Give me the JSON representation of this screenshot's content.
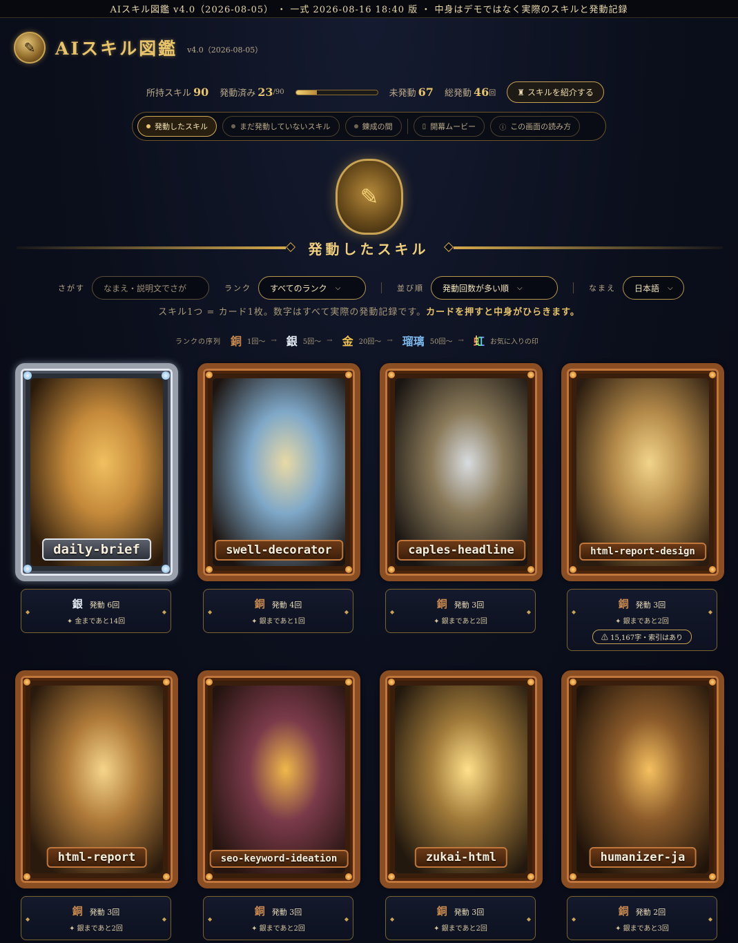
{
  "topbar": {
    "text": "AIスキル図鑑 v4.0（2026-08-05） ・ 一式 2026-08-16 18:40 版 ・ 中身はデモではなく実際のスキルと発動記録"
  },
  "header": {
    "title": "AIスキル図鑑",
    "version": "v4.0（2026-08-05）",
    "logo_icon": "book-emblem-icon"
  },
  "stats": {
    "owned_label": "所持スキル",
    "owned": "90",
    "used_label": "発動済み",
    "used": "23",
    "used_total": "/90",
    "progress_fraction": 0.2556,
    "unused_label": "未発動",
    "unused": "67",
    "total_label": "総発動",
    "total": "46",
    "total_unit": "回",
    "intro_button": "スキルを紹介する"
  },
  "nav": {
    "tabs": [
      {
        "label": "発動したスキル",
        "active": true
      },
      {
        "label": "まだ発動していないスキル",
        "active": false
      },
      {
        "label": "錬成の間",
        "active": false
      }
    ],
    "movie_label": "開幕ムービー",
    "howto_label": "この画面の読み方"
  },
  "section": {
    "title": "発動したスキル"
  },
  "filters": {
    "search_label": "さがす",
    "search_placeholder": "なまえ・説明文でさが",
    "rank_label": "ランク",
    "rank_value": "すべてのランク",
    "sort_label": "並び順",
    "sort_value": "発動回数が多い順",
    "name_label": "なまえ",
    "name_value": "日本語"
  },
  "note": {
    "text": "スキル1つ = カード1枚。数字はすべて実際の発動記録です。",
    "emphasis": "カードを押すと中身がひらきます。"
  },
  "ranks": {
    "label": "ランクの序列",
    "items": [
      {
        "glyph": "銅",
        "desc": "1回〜"
      },
      {
        "glyph": "銀",
        "desc": "5回〜"
      },
      {
        "glyph": "金",
        "desc": "20回〜"
      },
      {
        "glyph": "瑠璃",
        "desc": "50回〜"
      },
      {
        "glyph": "虹",
        "desc": "お気に入りの印"
      }
    ]
  },
  "cards": [
    {
      "name": "daily-brief",
      "frame": "silver",
      "rank": "銀",
      "count": "発動 6回",
      "next": "金まであと14回",
      "art": [
        "#2a1a0c",
        "#c58a3b",
        "#f0c060"
      ]
    },
    {
      "name": "swell-decorator",
      "frame": "bronze",
      "rank": "銅",
      "count": "発動 4回",
      "next": "銀まであと1回",
      "art": [
        "#1c1410",
        "#7fa8c8",
        "#e8d9a6"
      ]
    },
    {
      "name": "caples-headline",
      "frame": "bronze",
      "rank": "銅",
      "count": "発動 3回",
      "next": "銀まであと2回",
      "art": [
        "#1a1512",
        "#8a7a5a",
        "#d8dce0"
      ]
    },
    {
      "name": "html-report-design",
      "frame": "bronze",
      "rank": "銅",
      "count": "発動 3回",
      "next": "銀まであと2回",
      "warning": "15,167字・索引はあり",
      "art": [
        "#2a1c10",
        "#b48a4a",
        "#f2d48a"
      ]
    },
    {
      "name": "html-report",
      "frame": "bronze",
      "rank": "銅",
      "count": "発動 3回",
      "next": "銀まであと2回",
      "art": [
        "#2a1a0d",
        "#b07b3a",
        "#f5d58a"
      ]
    },
    {
      "name": "seo-keyword-ideation",
      "frame": "bronze",
      "rank": "銅",
      "count": "発動 3回",
      "next": "銀まであと2回",
      "art": [
        "#24140f",
        "#7a3a4a",
        "#f0b84a"
      ]
    },
    {
      "name": "zukai-html",
      "frame": "bronze",
      "rank": "銅",
      "count": "発動 3回",
      "next": "銀まであと2回",
      "art": [
        "#22180e",
        "#a07a3a",
        "#ffe08a"
      ]
    },
    {
      "name": "humanizer-ja",
      "frame": "bronze",
      "rank": "銅",
      "count": "発動 2回",
      "next": "銀まであと3回",
      "art": [
        "#20140a",
        "#8a5a2a",
        "#f5c060"
      ]
    }
  ]
}
